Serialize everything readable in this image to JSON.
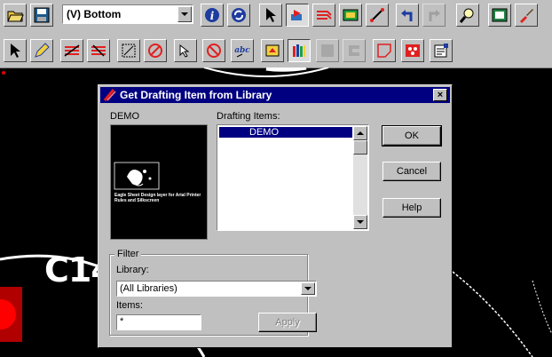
{
  "toolbar": {
    "layer_value": "(V) Bottom"
  },
  "canvas": {
    "label": "C14"
  },
  "dialog": {
    "title": "Get Drafting Item from Library",
    "close_label": "×",
    "preview_label": "DEMO",
    "preview_caption": "Eagle Sheet Design layer for Arial Printer Rules and Silkscreen",
    "items_label": "Drafting Items:",
    "items": [
      "DEMO"
    ],
    "ok_label": "OK",
    "cancel_label": "Cancel",
    "help_label": "Help",
    "filter": {
      "title": "Filter",
      "library_label": "Library:",
      "library_value": "(All Libraries)",
      "items_label": "Items:",
      "items_value": "*",
      "apply_label": "Apply"
    }
  },
  "colors": {
    "titlebar": "#000080",
    "face": "#c0c0c0",
    "canvas": "#000000",
    "pad_red": "#ff0000"
  }
}
